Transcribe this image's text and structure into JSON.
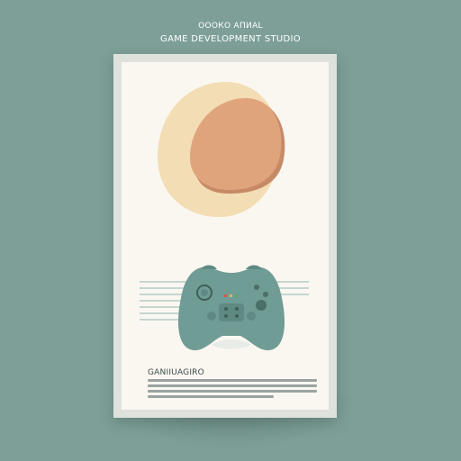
{
  "header": {
    "line1": "ОООКО АПИАL",
    "line2": "GAME DEVELOPMENT STUDIO"
  },
  "poster": {
    "caption_title": "GANIIUAGIRO",
    "caption_lines": 4
  },
  "icons": {
    "blob_back": "cream-blob",
    "blob_front": "peach-blob",
    "controller": "gamepad-icon"
  },
  "colors": {
    "background": "#7d9f98",
    "poster": "#faf7f1",
    "cream": "#f3ddb4",
    "peach": "#e0a47c",
    "controller": "#6f9c94"
  }
}
